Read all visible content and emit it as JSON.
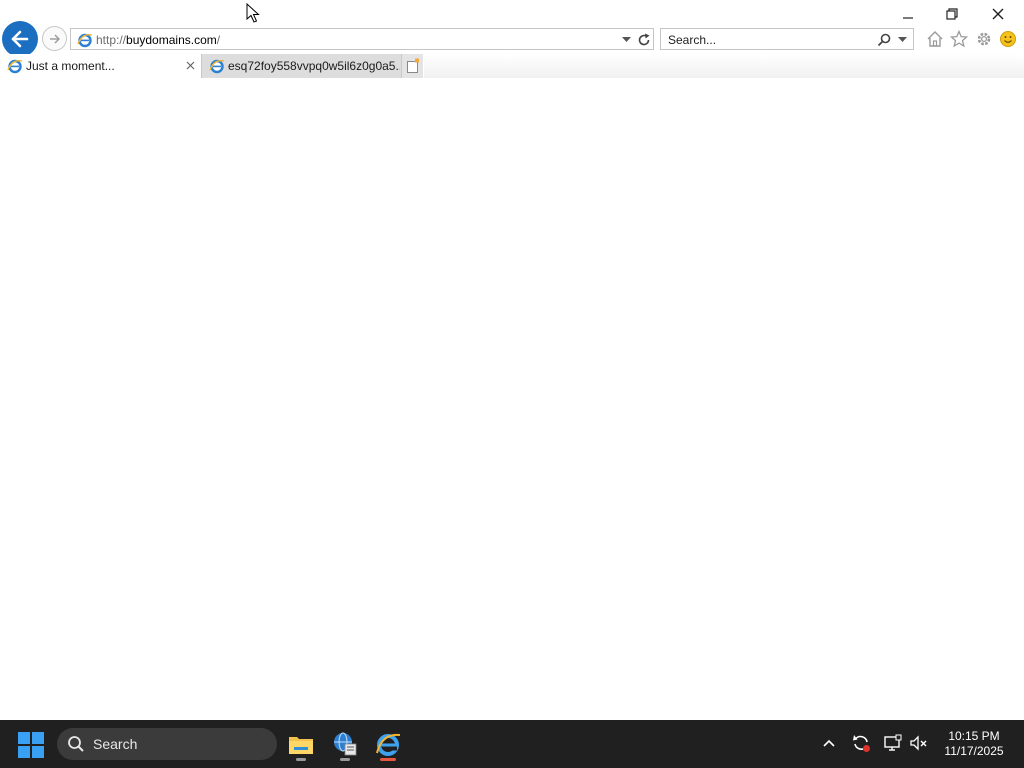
{
  "window": {
    "minimize_icon": "minimize-icon",
    "restore_icon": "restore-icon",
    "close_icon": "close-icon"
  },
  "toolbar": {
    "back_icon": "back-arrow-icon",
    "forward_icon": "forward-arrow-icon",
    "address": {
      "protocol": "http://",
      "host": "buydomains.com",
      "path": "/"
    },
    "search_placeholder": "Search...",
    "right_icons": [
      "home-icon",
      "favorites-star-icon",
      "settings-gear-icon",
      "feedback-smiley-icon"
    ]
  },
  "tabs": [
    {
      "label": "Just a moment...",
      "active": true
    },
    {
      "label": "esq72foy558vvpq0w5il6z0g0a5...",
      "active": false
    }
  ],
  "taskbar": {
    "search_label": "Search",
    "apps": [
      "file-explorer-icon",
      "network-settings-icon",
      "internet-explorer-icon"
    ],
    "active_app": "internet-explorer-icon",
    "tray_icons": [
      "chevron-up-icon",
      "sync-icon",
      "display-icon",
      "volume-muted-icon"
    ],
    "time": "10:15 PM",
    "date": "11/17/2025"
  },
  "colors": {
    "ie_blue": "#1c6fc0",
    "taskbar_bg": "#202020",
    "start_blue": "#3aa0f3",
    "active_indicator": "#e8573f"
  }
}
